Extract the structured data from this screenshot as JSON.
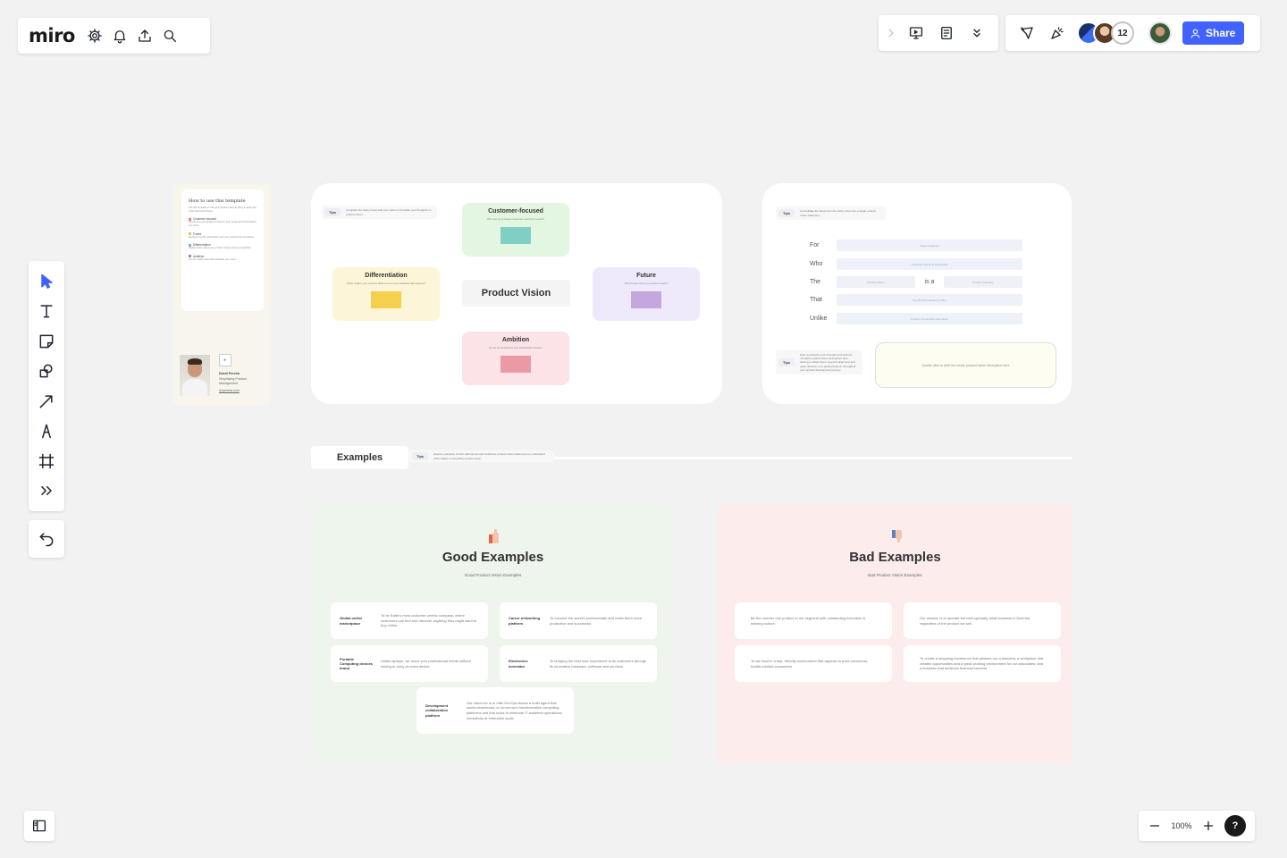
{
  "app": {
    "logo": "miro",
    "participant_count": "12",
    "share_label": "Share",
    "zoom": "100%",
    "help": "?",
    "accent": "#4262ff"
  },
  "template_sidebar": {
    "title": "How to use this template",
    "intro": "Use this template to craft your product vision by filling in each part of the framework below.",
    "items": [
      {
        "label": "Customer-focused",
        "desc": "Decide who your product is built for, their needs and what problem you solve."
      },
      {
        "label": "Future",
        "desc": "Envision how the world looks once your product has succeeded."
      },
      {
        "label": "Differentiation",
        "desc": "Explain what makes your product unique among competitors."
      },
      {
        "label": "Ambition",
        "desc": "Aim for a bold vision that motivates your team."
      }
    ],
    "author_name": "David Pereira",
    "author_role": "Simplifying Product Management",
    "author_link": "dvpereira.com"
  },
  "vision_card": {
    "tip_label": "Tips",
    "tip_text": "Complete the sticky boxes with your team to formulate your thoughts on product vision.",
    "center": "Product Vision",
    "boxes": {
      "customer": {
        "title": "Customer-focused",
        "sub": "Who are your target customers and their needs?",
        "color": "#e3f6e2",
        "swatch": "#7fcfc6"
      },
      "differentiation": {
        "title": "Differentiation",
        "sub": "What makes your product different from the available alternatives?",
        "color": "#fdf5d8",
        "swatch": "#f3d14e"
      },
      "future": {
        "title": "Future",
        "sub": "What future will your product create?",
        "color": "#eeeafc",
        "swatch": "#c5a6dd"
      },
      "ambition": {
        "title": "Ambition",
        "sub": "Go for an audacious and achievable mission.",
        "color": "#fbe3e7",
        "swatch": "#ea9aa5"
      }
    }
  },
  "statement_card": {
    "tip_label": "Tips",
    "tip_text": "Consolidate the ideas from the sticky notes into a single product vision statement.",
    "rows": [
      {
        "label": "For",
        "placeholder": "Target Audience"
      },
      {
        "label": "Who",
        "placeholder": "Customer Needs & Desirability"
      },
      {
        "label": "The",
        "placeholder": "Product Name",
        "mid": "is a",
        "placeholder2": "Product Category"
      },
      {
        "label": "That",
        "placeholder": "Key Benefit / Reason to Buy"
      },
      {
        "label": "Unlike",
        "placeholder": "Primary Competitive Alternative"
      }
    ],
    "tip2_label": "Tips",
    "tip2_text": "Now, synthesize your thoughts and draft the complete product vision description here. Having a visible vision supports alignment and gives direction on a guiding beacon throughout your product development journey.",
    "description_placeholder": "Double click to write the whole product vision description here"
  },
  "examples_bar": {
    "title": "Examples",
    "tip_label": "Tips",
    "tip_text": "Explore examples of both well-formed and ineffective product vision statements to understand what makes a compelling product vision."
  },
  "good": {
    "title": "Good Examples",
    "subtitle": "Good Product Vision Examples",
    "items": [
      {
        "key": "Global online marketplace",
        "desc": "To be Earth's most customer-centric company, where customers can find and discover anything they might want to buy online."
      },
      {
        "key": "Career networking platform",
        "desc": "To connect the world's professionals and make them more productive and successful."
      },
      {
        "key": "Portable Computing devices brand",
        "desc": "Unlike laptops, we move your professional needs without having to carry an extra device."
      },
      {
        "key": "Electronics innovator",
        "desc": "To bringing the best user experience to its customers through its innovative hardware, software and services."
      },
      {
        "key": "Development collaboration platform",
        "desc": "Our vision for is to offer DevOps teams a build agent that works seamlessly on tomorrow's transformative computing platforms and that looks to eliminate IT build/test operational complexity at enterprise scale."
      }
    ]
  },
  "bad": {
    "title": "Bad Examples",
    "subtitle": "Bad Product Vision Examples",
    "items": [
      "Be the number one product in our segment with outstanding execution & winning culture.",
      "Our mission is to operate the best specialty retail business in America, regardless of the product we sell.",
      "To win food in a fast, friendly environment that appeals to price-conscious, health-minded consumers.",
      "To create a shopping experience that pleases our customers; a workplace that creates opportunities and a great working environment for our associates; and a business that achieves financial success."
    ]
  }
}
